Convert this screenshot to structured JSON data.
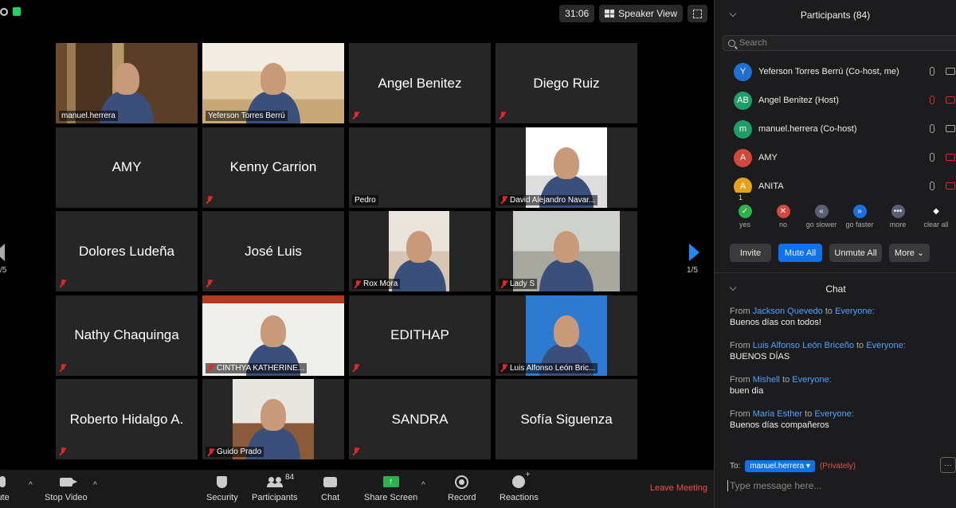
{
  "meeting": {
    "timer": "31:06",
    "view_label": "Speaker View",
    "page_indicator": "1/5",
    "page_indicator_left": "/5"
  },
  "tiles": [
    {
      "name": "manuel.herrera",
      "video": true,
      "label": "manuel.herrera",
      "active": true,
      "muted": false
    },
    {
      "name": "Yeferson Torres Berrú",
      "video": true,
      "label": "Yeferson Torres Berrú",
      "muted": false
    },
    {
      "name": "Angel Benitez",
      "video": false,
      "muted": true
    },
    {
      "name": "Diego Ruiz",
      "video": false,
      "muted": true
    },
    {
      "name": "AMY",
      "video": false,
      "muted": false
    },
    {
      "name": "Kenny Carrion",
      "video": false,
      "muted": true
    },
    {
      "name": "",
      "video": false,
      "label": "Pedro",
      "muted": false
    },
    {
      "name": "David Alejandro Navar...",
      "video": true,
      "label": "David Alejandro Navar...",
      "muted": true
    },
    {
      "name": "Dolores Ludeña",
      "video": false,
      "muted": true
    },
    {
      "name": "José Luis",
      "video": false,
      "muted": true
    },
    {
      "name": "Rox Mora",
      "video": true,
      "label": "Rox Mora",
      "muted": true
    },
    {
      "name": "Lady S",
      "video": true,
      "label": "Lady S",
      "muted": true
    },
    {
      "name": "Nathy Chaquinga",
      "video": false,
      "muted": true
    },
    {
      "name": "CINTHYA KATHERINE...",
      "video": true,
      "label": "CINTHYA KATHERINE...",
      "muted": true
    },
    {
      "name": "EDITHAP",
      "video": false,
      "muted": true
    },
    {
      "name": "Luis Alfonso León Bric...",
      "video": true,
      "label": "Luis Alfonso León Bric...",
      "muted": true
    },
    {
      "name": "Roberto Hidalgo A.",
      "video": false,
      "muted": true
    },
    {
      "name": "Guido Prado",
      "video": true,
      "label": "Guido Prado",
      "muted": true
    },
    {
      "name": "SANDRA",
      "video": false,
      "muted": true
    },
    {
      "name": "Sofía Siguenza",
      "video": false,
      "muted": false
    }
  ],
  "toolbar": {
    "mute_label": "lute",
    "stop_video_label": "Stop Video",
    "security_label": "Security",
    "participants_label": "Participants",
    "participants_count": "84",
    "chat_label": "Chat",
    "share_label": "Share Screen",
    "record_label": "Record",
    "reactions_label": "Reactions",
    "leave_label": "Leave Meeting",
    "caret": "^",
    "share_arrow": "↑"
  },
  "participants_panel": {
    "title": "Participants (84)",
    "search_placeholder": "Search",
    "list": [
      {
        "initials": "Y",
        "name": "Yeferson Torres Berrú (Co-host, me)",
        "color": "#1f6fd1",
        "mic_off": false,
        "cam_off": false
      },
      {
        "initials": "AB",
        "name": "Angel Benitez (Host)",
        "color": "#1f9e6a",
        "mic_off": true,
        "cam_off": true
      },
      {
        "initials": "m",
        "name": "manuel.herrera (Co-host)",
        "color": "#1f9e6a",
        "mic_off": false,
        "cam_off": false
      },
      {
        "initials": "A",
        "name": "AMY",
        "color": "#d04a3c",
        "mic_off": false,
        "cam_off": true
      },
      {
        "initials": "A",
        "name": "ANITA",
        "color": "#e8a21a",
        "mic_off": false,
        "cam_off": true
      }
    ],
    "feedback": [
      {
        "label": "yes",
        "color": "#2bb24c",
        "glyph": "✓"
      },
      {
        "label": "no",
        "color": "#d04a3c",
        "glyph": "✕"
      },
      {
        "label": "go slower",
        "color": "#5a5f73",
        "glyph": "«"
      },
      {
        "label": "go faster",
        "color": "#1d6fe0",
        "glyph": "»"
      },
      {
        "label": "more",
        "color": "#5a5f73",
        "glyph": "•••"
      },
      {
        "label": "clear all",
        "color": "transparent",
        "glyph": "◆"
      }
    ],
    "feedback_count": "1",
    "invite_label": "Invite",
    "mute_all_label": "Mute All",
    "unmute_all_label": "Unmute All",
    "more_label": "More ⌄"
  },
  "chat": {
    "title": "Chat",
    "messages": [
      {
        "from": "Jackson Quevedo",
        "to": "Everyone:",
        "text": "Buenos días con todos!"
      },
      {
        "from": "Luis Alfonso León Briceño",
        "to": "Everyone:",
        "text": "BUENOS DÍAS"
      },
      {
        "from": "Mishell",
        "to": "Everyone:",
        "text": "buen dia"
      },
      {
        "from": "Maria Esther",
        "to": "Everyone:",
        "text": "Buenos días compañeros"
      }
    ],
    "from_word": "From",
    "to_word": "to",
    "to_label": "To:",
    "recipient": "manuel.herrera ▾",
    "privately": "(Privately)",
    "input_placeholder": "Type message here...",
    "more_glyph": "···"
  }
}
